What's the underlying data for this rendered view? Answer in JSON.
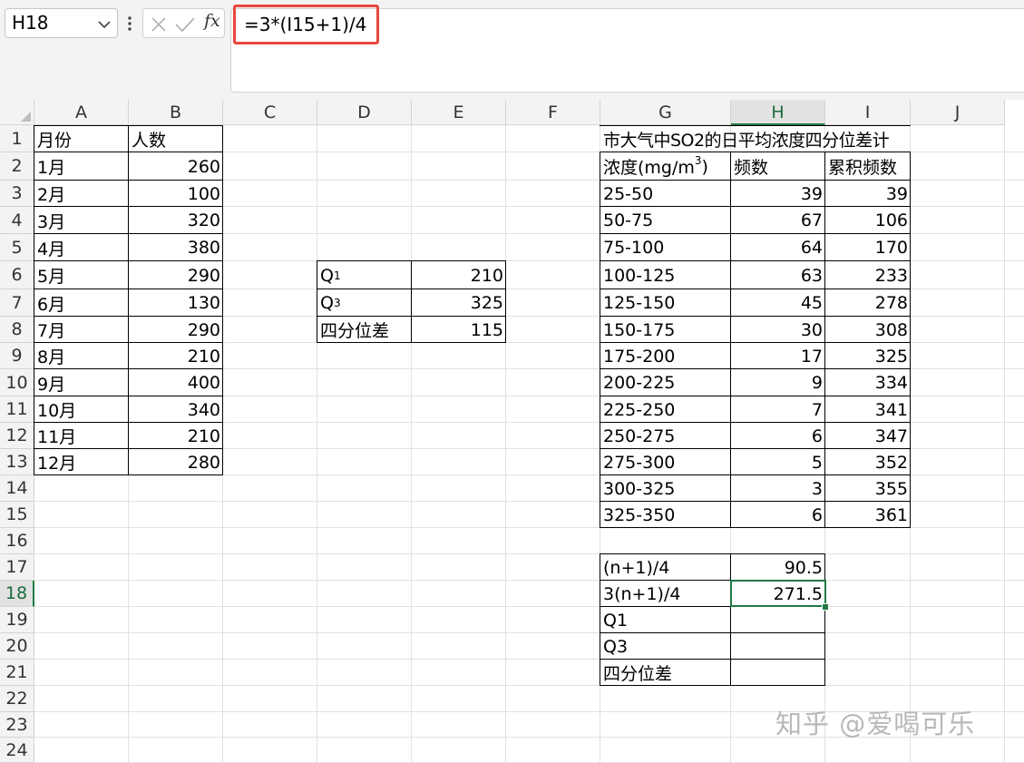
{
  "formula_bar": {
    "name_box": "H18",
    "fx_label": "fx",
    "formula": "=3*(I15+1)/4"
  },
  "columns": [
    "A",
    "B",
    "C",
    "D",
    "E",
    "F",
    "G",
    "H",
    "I",
    "J"
  ],
  "rows": [
    "1",
    "2",
    "3",
    "4",
    "5",
    "6",
    "7",
    "8",
    "9",
    "10",
    "11",
    "12",
    "13",
    "14",
    "15",
    "16",
    "17",
    "18",
    "19",
    "20",
    "21",
    "22",
    "23",
    "24"
  ],
  "selected": {
    "column": "H",
    "row": "18"
  },
  "table1": {
    "header_month": "月份",
    "header_count": "人数",
    "rows": [
      {
        "month": "1月",
        "count": "260"
      },
      {
        "month": "2月",
        "count": "100"
      },
      {
        "month": "3月",
        "count": "320"
      },
      {
        "month": "4月",
        "count": "380"
      },
      {
        "month": "5月",
        "count": "290"
      },
      {
        "month": "6月",
        "count": "130"
      },
      {
        "month": "7月",
        "count": "290"
      },
      {
        "month": "8月",
        "count": "210"
      },
      {
        "month": "9月",
        "count": "400"
      },
      {
        "month": "10月",
        "count": "340"
      },
      {
        "month": "11月",
        "count": "210"
      },
      {
        "month": "12月",
        "count": "280"
      }
    ]
  },
  "table2": {
    "q1_letter": "Q",
    "q1_sub": "1",
    "q1_value": "210",
    "q3_letter": "Q",
    "q3_sub": "3",
    "q3_value": "325",
    "iqr_label": "四分位差",
    "iqr_value": "115"
  },
  "table3": {
    "title": "市大气中SO2的日平均浓度四分位差计",
    "header_conc": "浓度(mg/m",
    "header_conc_sup": "3",
    "header_conc_end": ")",
    "header_freq": "频数",
    "header_cum": "累积频数",
    "rows": [
      {
        "range": "25-50",
        "freq": "39",
        "cum": "39"
      },
      {
        "range": "50-75",
        "freq": "67",
        "cum": "106"
      },
      {
        "range": "75-100",
        "freq": "64",
        "cum": "170"
      },
      {
        "range": "100-125",
        "freq": "63",
        "cum": "233"
      },
      {
        "range": "125-150",
        "freq": "45",
        "cum": "278"
      },
      {
        "range": "150-175",
        "freq": "30",
        "cum": "308"
      },
      {
        "range": "175-200",
        "freq": "17",
        "cum": "325"
      },
      {
        "range": "200-225",
        "freq": "9",
        "cum": "334"
      },
      {
        "range": "225-250",
        "freq": "7",
        "cum": "341"
      },
      {
        "range": "250-275",
        "freq": "6",
        "cum": "347"
      },
      {
        "range": "275-300",
        "freq": "5",
        "cum": "352"
      },
      {
        "range": "300-325",
        "freq": "3",
        "cum": "355"
      },
      {
        "range": "325-350",
        "freq": "6",
        "cum": "361"
      }
    ]
  },
  "table4": {
    "rows": [
      {
        "label": "(n+1)/4",
        "value": "90.5"
      },
      {
        "label": "3(n+1)/4",
        "value": "271.5"
      },
      {
        "label": "Q1",
        "value": ""
      },
      {
        "label": "Q3",
        "value": ""
      },
      {
        "label": "四分位差",
        "value": ""
      }
    ]
  },
  "watermark": "知乎 @爱喝可乐",
  "colors": {
    "accent": "#1f7a45",
    "highlight": "#e8483f",
    "gridline": "#e1e1e1",
    "header_bg": "#f3f3f3"
  }
}
